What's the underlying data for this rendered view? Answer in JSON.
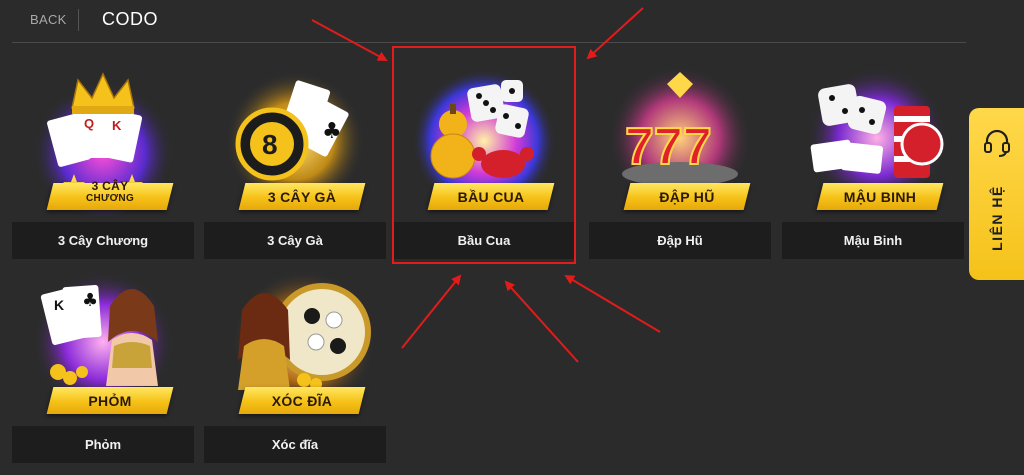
{
  "header": {
    "back_label": "BACK",
    "title": "CODO"
  },
  "games": [
    {
      "banner": "3 CÂY",
      "banner_sub": "CHƯƠNG",
      "label": "3 Cây Chương"
    },
    {
      "banner": "3 CÂY GÀ",
      "label": "3 Cây Gà"
    },
    {
      "banner": "BẦU CUA",
      "label": "Bầu Cua"
    },
    {
      "banner": "ĐẬP HŨ",
      "label": "Đập Hũ"
    },
    {
      "banner": "MẬU BINH",
      "label": "Mậu Binh"
    },
    {
      "banner": "PHỎM",
      "label": "Phỏm"
    },
    {
      "banner": "XÓC ĐĨA",
      "label": "Xóc đĩa"
    }
  ],
  "side_tab": {
    "label": "LIÊN HỆ",
    "icon": "headset-icon"
  },
  "colors": {
    "background": "#2b2b2c",
    "banner": "#f6c118",
    "label_bg": "#1d1d1e",
    "highlight": "#e21b1b",
    "side_tab": "#f5c21a"
  }
}
